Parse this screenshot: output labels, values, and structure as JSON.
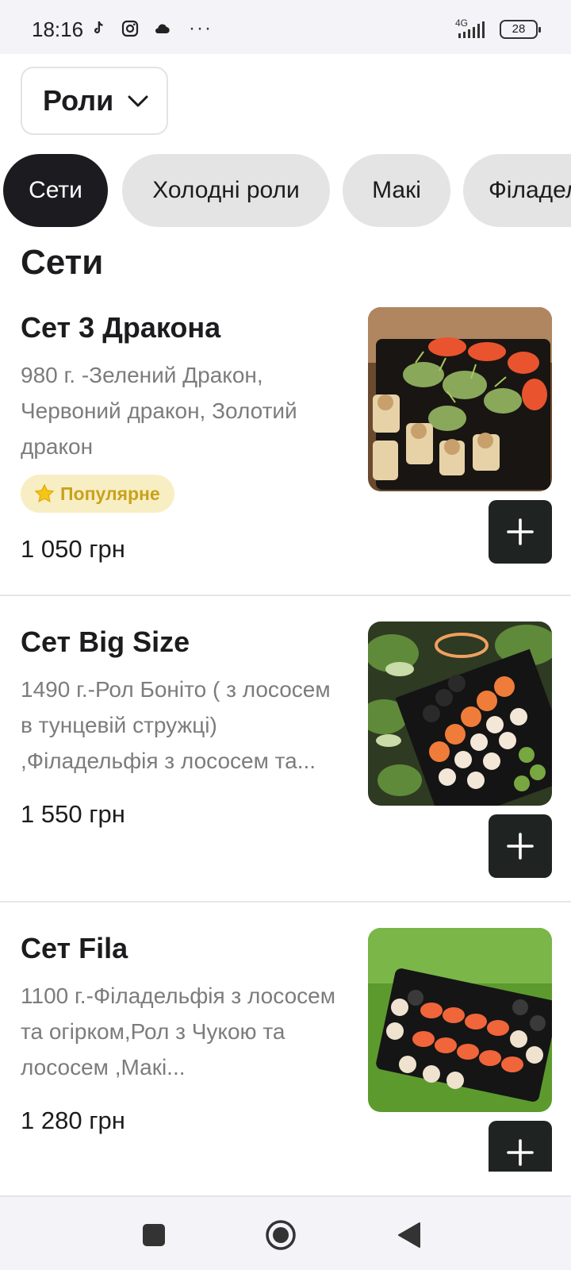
{
  "status_bar": {
    "time": "18:16",
    "left_icons": [
      "tiktok-icon",
      "instagram-icon",
      "cloud-icon"
    ],
    "more": "···",
    "network": "4G",
    "battery": "28"
  },
  "category_select": {
    "value": "Роли"
  },
  "chips": [
    {
      "label": "Сети",
      "active": true
    },
    {
      "label": "Холодні роли",
      "active": false
    },
    {
      "label": "Макі",
      "active": false
    },
    {
      "label": "Філадельфія",
      "active": false
    }
  ],
  "section_title": "Сети",
  "products": [
    {
      "name": "Сет 3 Дракона",
      "description": "980 г. -Зелений Дракон, Червоний дракон, Золотий дракон",
      "badge": "Популярне",
      "price": "1 050 грн"
    },
    {
      "name": "Сет Big Size",
      "description": "1490 г.-Рол Боніто ( з лососем в тунцевій стружці) ,Філадельфія з лососем та...",
      "price": "1 550 грн"
    },
    {
      "name": "Сет Fila",
      "description": "1100 г.-Філадельфія з лососем та огірком,Рол з Чукою та лососем ,Макі...",
      "price": "1 280 грн"
    }
  ],
  "colors": {
    "accent_dark": "#1c1b1f",
    "chip_inactive": "#e4e4e4",
    "badge_bg": "#f8eec4",
    "badge_text": "#c9a21b",
    "add_button": "#1f2423"
  }
}
